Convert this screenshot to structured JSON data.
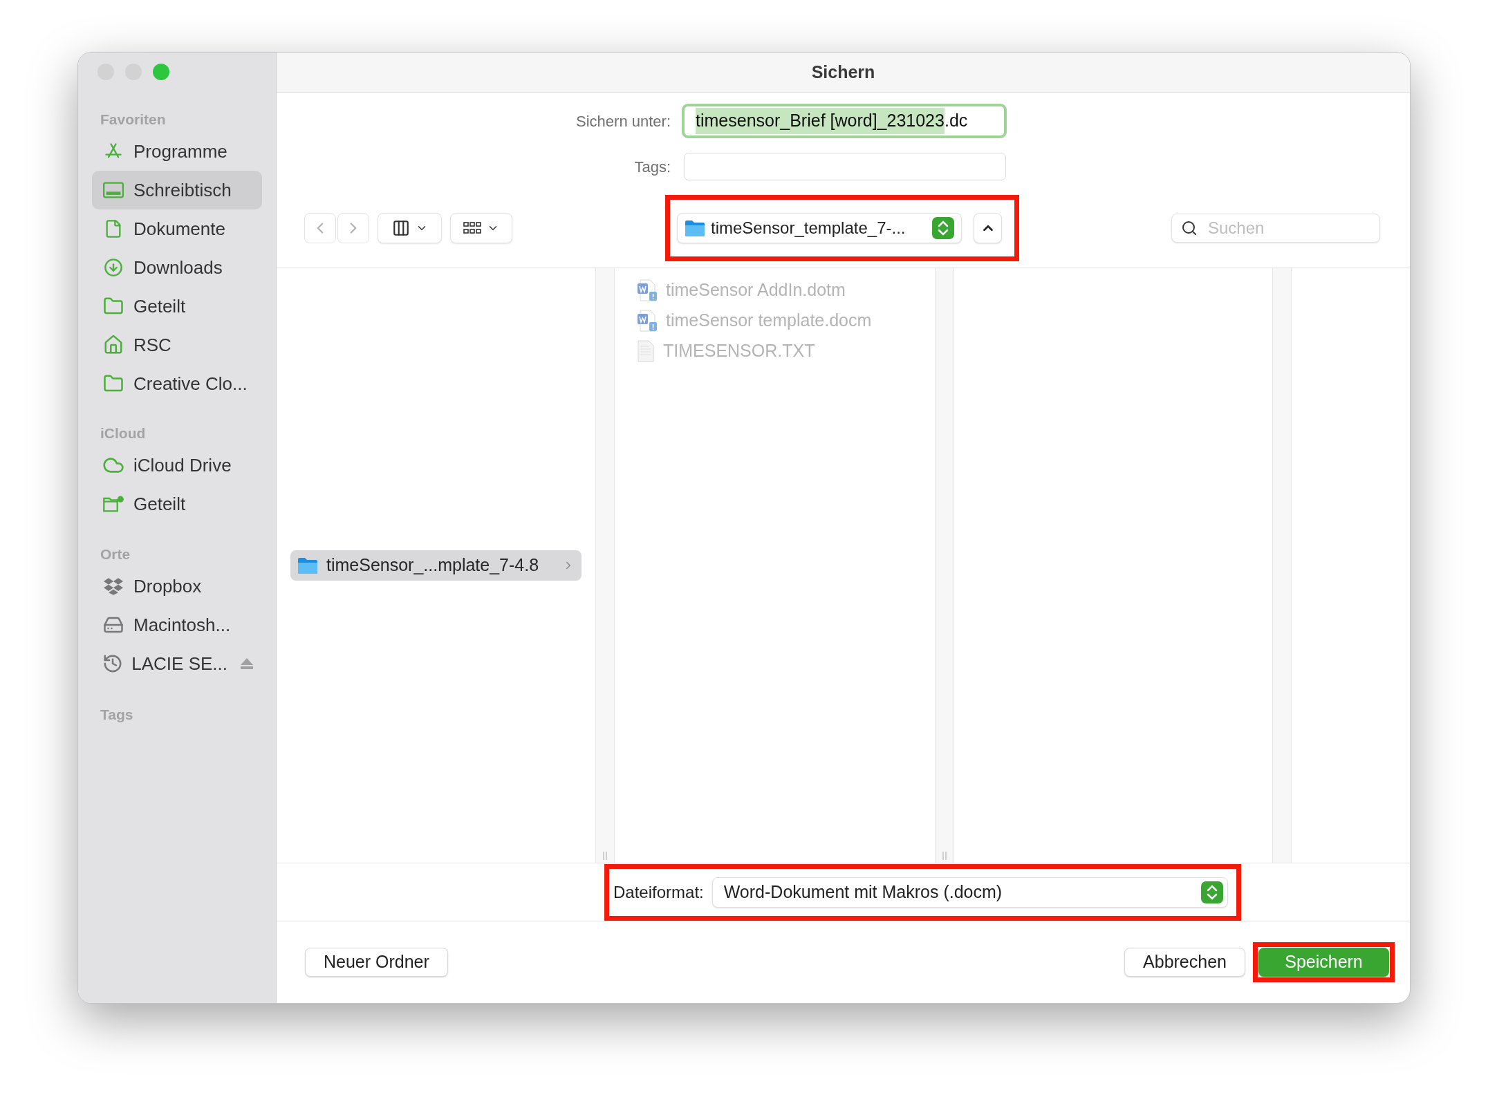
{
  "window": {
    "title": "Sichern",
    "controls": [
      {
        "color": "#d2d2d2"
      },
      {
        "color": "#d2d2d2"
      },
      {
        "color": "#2cc63f"
      }
    ]
  },
  "sidebar": {
    "sections": [
      {
        "title": "Favoriten",
        "items": [
          {
            "label": "Programme",
            "selected": false
          },
          {
            "label": "Schreibtisch",
            "selected": true
          },
          {
            "label": "Dokumente",
            "selected": false
          },
          {
            "label": "Downloads",
            "selected": false
          },
          {
            "label": "Geteilt",
            "selected": false
          },
          {
            "label": "RSC",
            "selected": false
          },
          {
            "label": "Creative Clo...",
            "selected": false
          }
        ]
      },
      {
        "title": "iCloud",
        "items": [
          {
            "label": "iCloud Drive",
            "selected": false
          },
          {
            "label": "Geteilt",
            "selected": false
          }
        ]
      },
      {
        "title": "Orte",
        "items": [
          {
            "label": "Dropbox",
            "selected": false,
            "ejectable": false
          },
          {
            "label": "Macintosh...",
            "selected": false,
            "ejectable": false
          },
          {
            "label": "LACIE SE...",
            "selected": false,
            "ejectable": true
          }
        ]
      },
      {
        "title": "Tags"
      }
    ]
  },
  "save_as": {
    "label": "Sichern unter:",
    "selected_text": "timesensor_Brief [word]_231023",
    "unselected_text": ".dc",
    "focused": true
  },
  "tags": {
    "label": "Tags:"
  },
  "location": {
    "label": "timeSensor_template_7-...",
    "highlighted": true
  },
  "search": {
    "placeholder": "Suchen"
  },
  "columns": [
    {
      "items": [
        {
          "name": "timeSensor_...mplate_7-4.8",
          "kind": "folder",
          "selected": true,
          "disabled": false
        }
      ]
    },
    {
      "items": [
        {
          "name": "timeSensor AddIn.dotm",
          "kind": "word",
          "selected": false,
          "disabled": true
        },
        {
          "name": "timeSensor template.docm",
          "kind": "word",
          "selected": false,
          "disabled": true
        },
        {
          "name": "TIMESENSOR.TXT",
          "kind": "text",
          "selected": false,
          "disabled": true
        }
      ]
    }
  ],
  "file_format": {
    "label": "Dateiformat:",
    "value": "Word-Dokument mit Makros (.docm)",
    "highlighted": true
  },
  "left_buttons": [
    {
      "label": "Neuer Ordner",
      "kind": "plain",
      "highlighted": false
    }
  ],
  "right_buttons": [
    {
      "label": "Abbrechen",
      "kind": "plain",
      "highlighted": false
    },
    {
      "label": "Speichern",
      "kind": "default",
      "highlighted": true
    }
  ]
}
